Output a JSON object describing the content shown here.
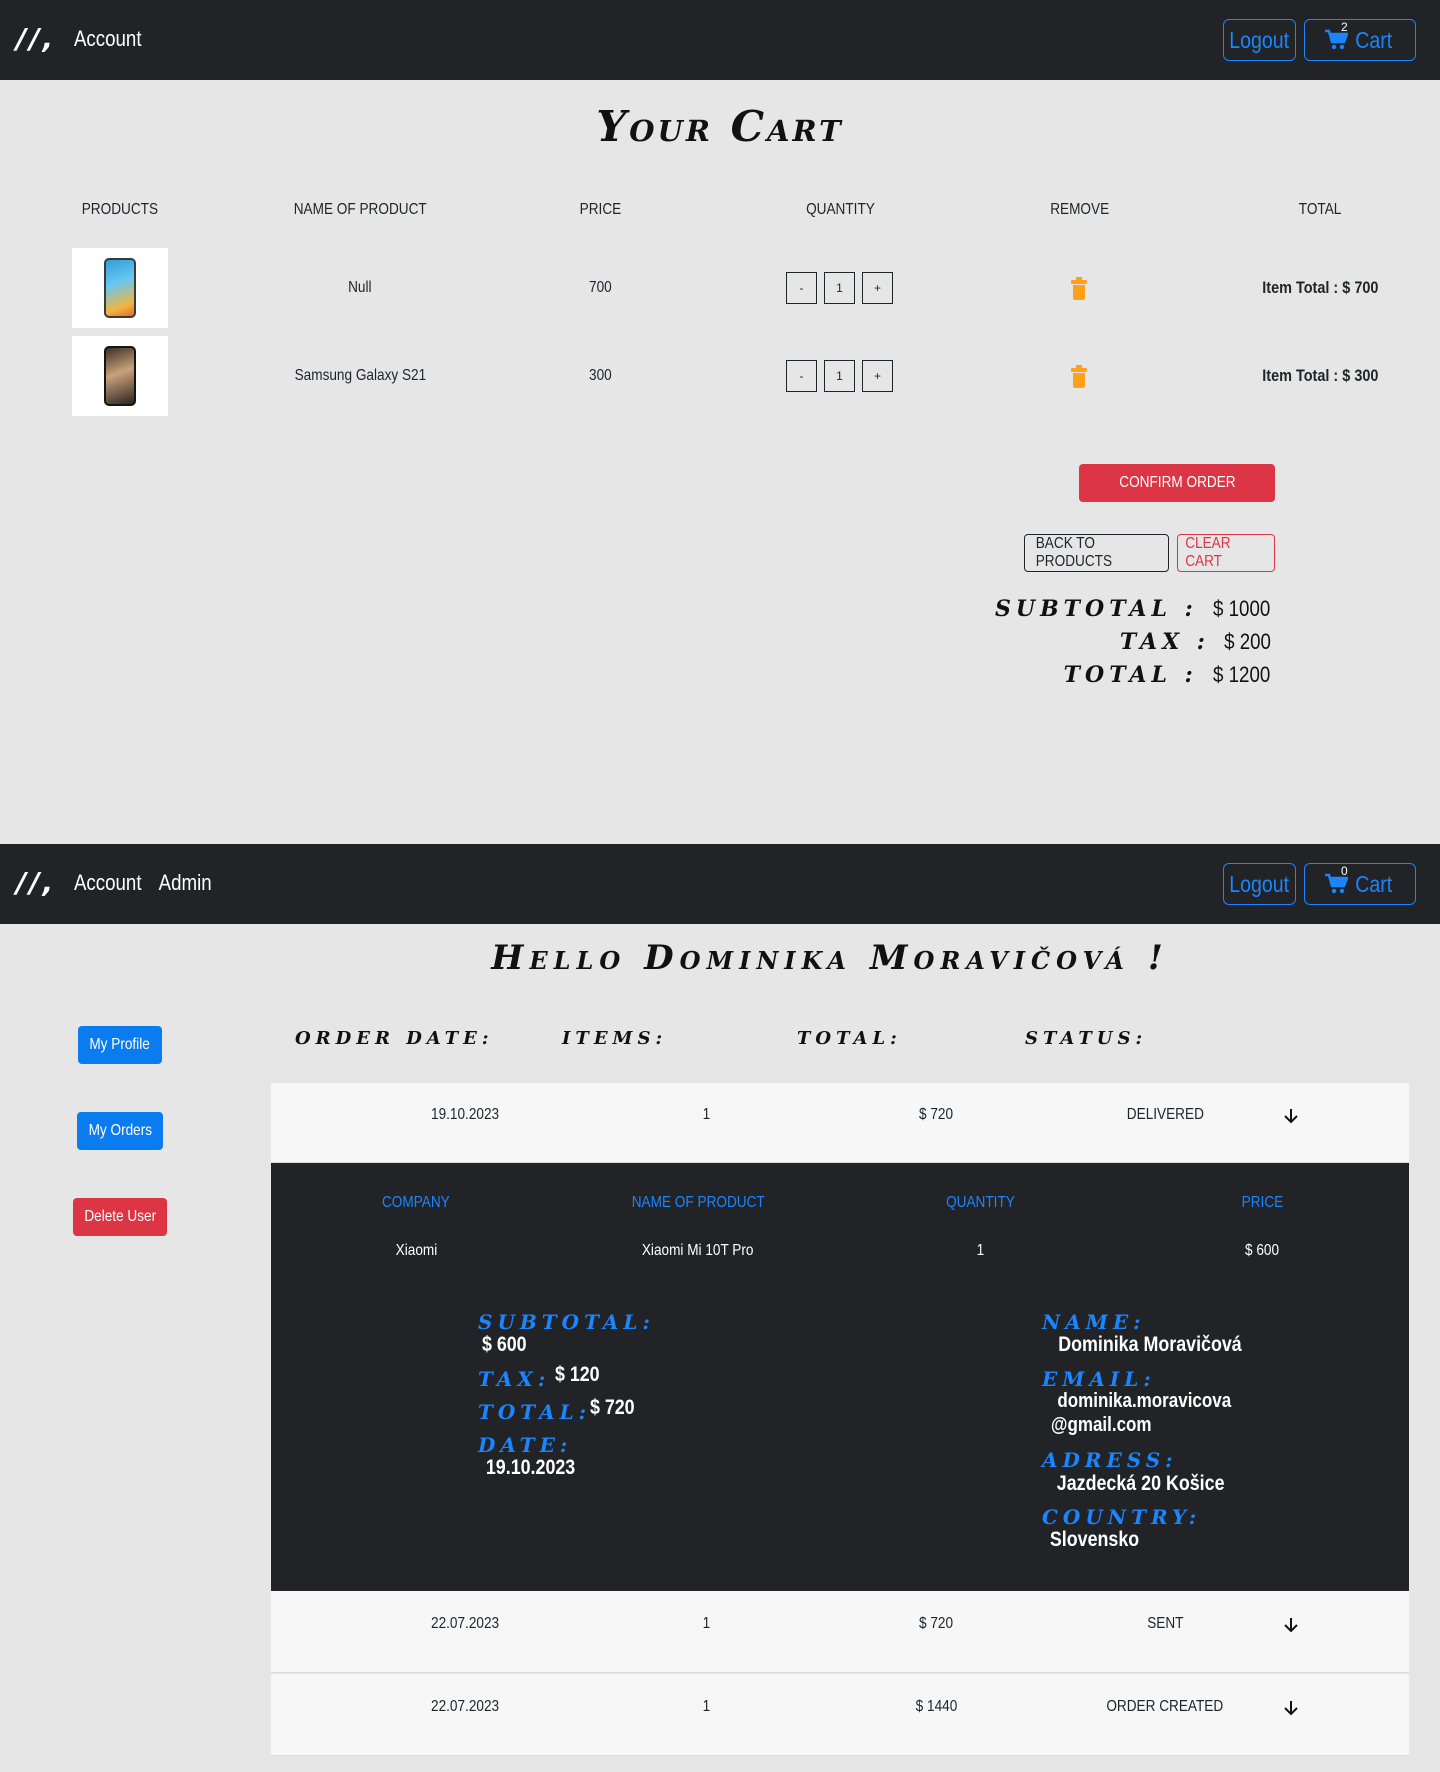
{
  "cart_page": {
    "nav": {
      "logo": "//,",
      "links": [
        "Account"
      ],
      "logout_label": "Logout",
      "cart_label": "Cart",
      "cart_count": "2"
    },
    "title": "Your Cart",
    "headers": [
      "Products",
      "Name of product",
      "Price",
      "Quantity",
      "Remove",
      "Total"
    ],
    "items": [
      {
        "name": "Null",
        "price": "700",
        "qty": "1",
        "minus": "-",
        "plus": "+",
        "total": "Item Total : $ 700"
      },
      {
        "name": "Samsung Galaxy S21",
        "price": "300",
        "qty": "1",
        "minus": "-",
        "plus": "+",
        "total": "Item Total : $ 300"
      }
    ],
    "confirm_label": "Confirm order",
    "back_label": "Back to products",
    "clear_label": "Clear cart",
    "summary": {
      "subtotal_label": "Subtotal :",
      "subtotal": "$ 1000",
      "tax_label": "Tax :",
      "tax": "$ 200",
      "total_label": "Total :",
      "total": "$ 1200"
    }
  },
  "account_page": {
    "nav": {
      "logo": "//,",
      "links": [
        "Account",
        "Admin"
      ],
      "logout_label": "Logout",
      "cart_label": "Cart",
      "cart_count": "0"
    },
    "title": "Hello Dominika Moravičová !",
    "side_buttons": {
      "profile": "My Profile",
      "orders": "My Orders",
      "delete": "Delete User"
    },
    "order_headers": [
      "Order date:",
      "Items:",
      "Total:",
      "Status:"
    ],
    "orders": [
      {
        "date": "19.10.2023",
        "items": "1",
        "total": "$ 720",
        "status": "Delivered"
      },
      {
        "date": "22.07.2023",
        "items": "1",
        "total": "$ 720",
        "status": "Sent"
      },
      {
        "date": "22.07.2023",
        "items": "1",
        "total": "$ 1440",
        "status": "Order created"
      }
    ],
    "detail": {
      "headers": [
        "Company",
        "Name of product",
        "Quantity",
        "Price"
      ],
      "row": [
        "Xiaomi",
        "Xiaomi Mi 10T Pro",
        "1",
        "$ 600"
      ],
      "subtotal_label": "Subtotal:",
      "subtotal": "$ 600",
      "tax_label": "Tax:",
      "tax": "$ 120",
      "total_label": "Total:",
      "total": "$ 720",
      "date_label": "Date:",
      "date": "19.10.2023",
      "name_label": "Name:",
      "name": "Dominika Moravičová",
      "email_label": "Email:",
      "email_1": "dominika.moravicova",
      "email_2": "@gmail.com",
      "address_label": "Adress:",
      "address": "Jazdecká 20 Košice",
      "country_label": "Country:",
      "country": "Slovensko"
    }
  },
  "colors": {
    "navbar": "#212326",
    "accent_blue": "#1b85ff",
    "danger": "#dc3545",
    "trash": "#ff9f1a",
    "page_bg": "#e6e6e6"
  },
  "icons": [
    "cart-icon",
    "trash-icon",
    "arrow-down-icon",
    "logo-icon"
  ]
}
